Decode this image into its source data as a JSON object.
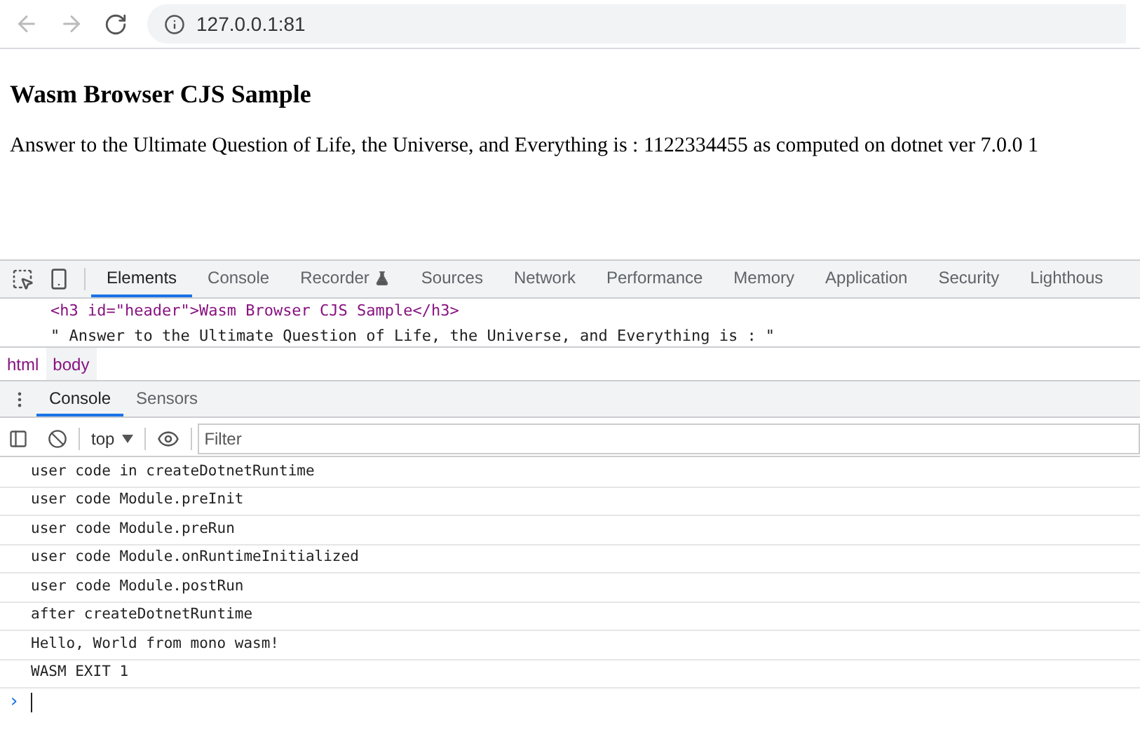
{
  "address_bar": {
    "url": "127.0.0.1:81"
  },
  "page": {
    "heading": "Wasm Browser CJS Sample",
    "paragraph": "Answer to the Ultimate Question of Life, the Universe, and Everything is : 1122334455 as computed on dotnet ver 7.0.0 1"
  },
  "devtools_tabs": [
    {
      "label": "Elements",
      "selected": true
    },
    {
      "label": "Console",
      "selected": false
    },
    {
      "label": "Recorder",
      "selected": false,
      "kind": "flask"
    },
    {
      "label": "Sources",
      "selected": false
    },
    {
      "label": "Network",
      "selected": false
    },
    {
      "label": "Performance",
      "selected": false
    },
    {
      "label": "Memory",
      "selected": false
    },
    {
      "label": "Application",
      "selected": false
    },
    {
      "label": "Security",
      "selected": false
    },
    {
      "label": "Lighthous",
      "selected": false
    }
  ],
  "elements_lines": [
    "<h3 id=\"header\">Wasm Browser CJS Sample</h3>",
    "\" Answer to the Ultimate Question of Life, the Universe, and Everything is : \""
  ],
  "breadcrumbs": [
    {
      "label": "html",
      "selected": false
    },
    {
      "label": "body",
      "selected": true
    }
  ],
  "drawer_tabs": [
    {
      "label": "Console",
      "selected": true
    },
    {
      "label": "Sensors",
      "selected": false
    }
  ],
  "console_toolbar": {
    "context": "top",
    "filter_placeholder": "Filter"
  },
  "console_lines": [
    "user code in createDotnetRuntime",
    "user code Module.preInit",
    "user code Module.preRun",
    "user code Module.onRuntimeInitialized",
    "user code Module.postRun",
    "after createDotnetRuntime",
    "Hello, World from mono wasm!",
    "WASM EXIT 1"
  ],
  "prompt": {
    "symbol": "›"
  }
}
